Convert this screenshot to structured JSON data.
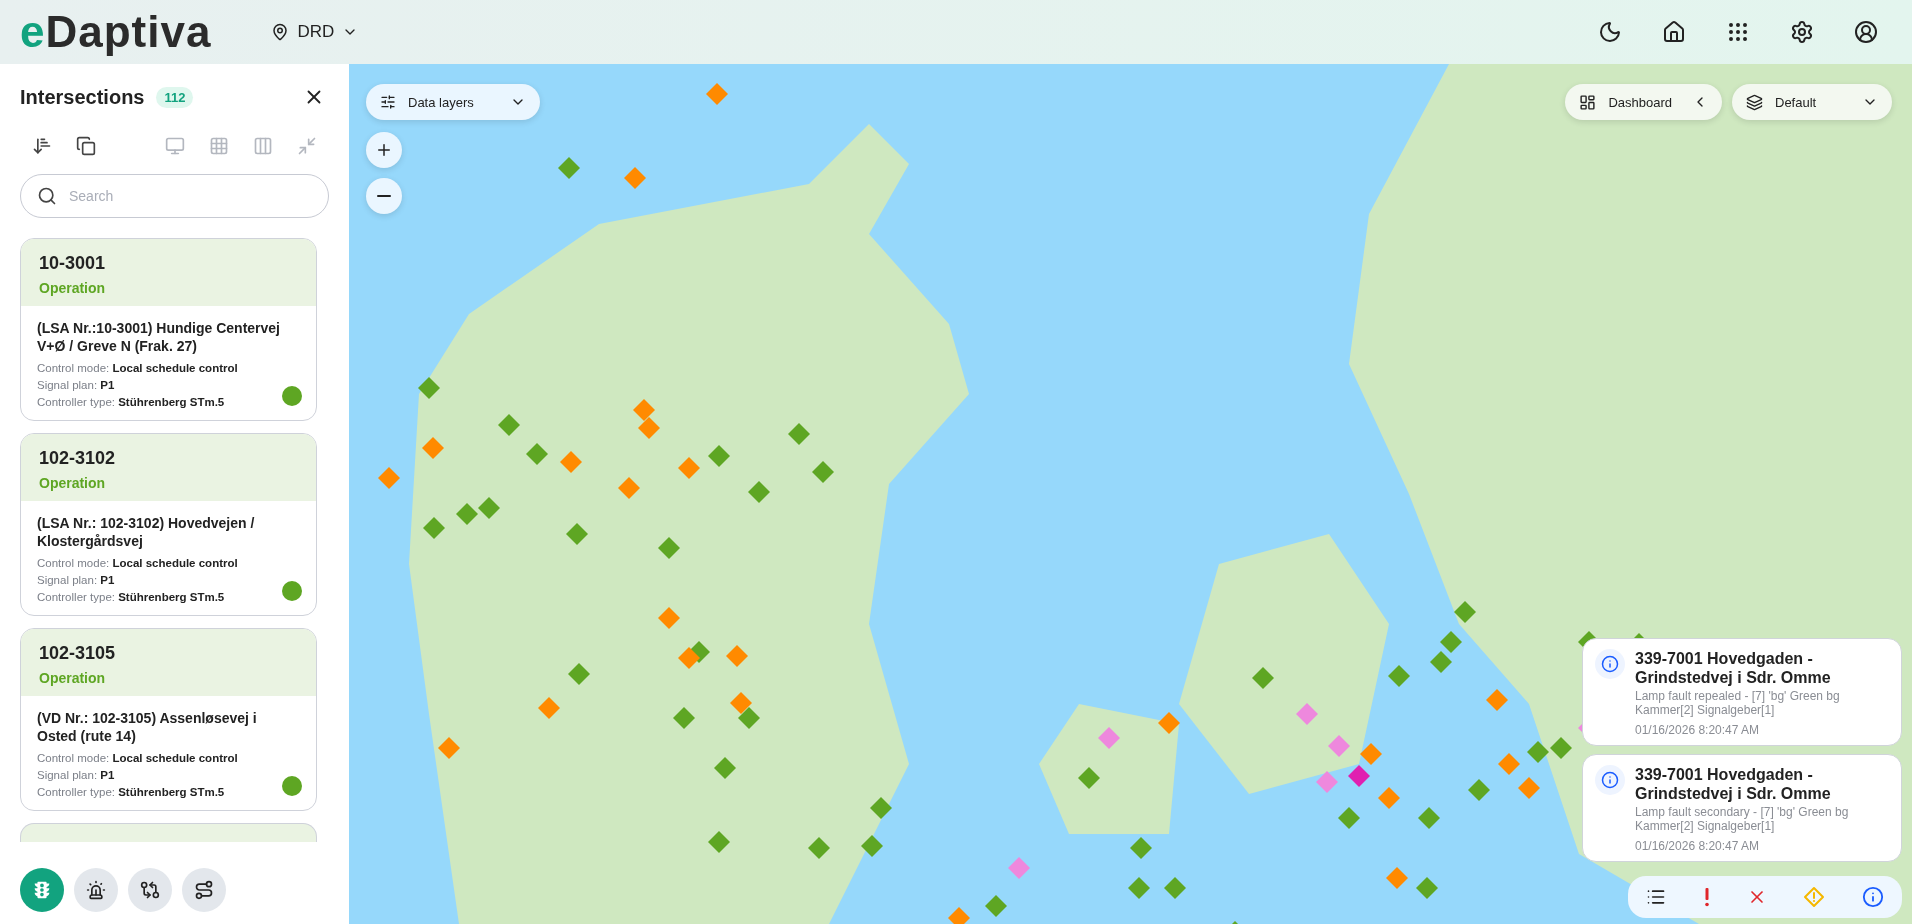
{
  "header": {
    "logo": {
      "accent": "e",
      "rest": "Daptiva"
    },
    "location": "DRD"
  },
  "sidebar": {
    "title": "Intersections",
    "count": "112",
    "search": {
      "placeholder": "Search"
    },
    "cards": [
      {
        "id": "10-3001",
        "status": "Operation",
        "title": "(LSA Nr.:10-3001) Hundige Centervej V+Ø / Greve N (Frak. 27)",
        "fields": [
          {
            "label": "Control mode:",
            "value": "Local schedule control"
          },
          {
            "label": "Signal plan:",
            "value": "P1"
          },
          {
            "label": "Controller type:",
            "value": "Stührenberg STm.5"
          }
        ],
        "color": "#5ea623"
      },
      {
        "id": "102-3102",
        "status": "Operation",
        "title": "(LSA Nr.: 102-3102) Hovedvejen / Klostergårdsvej",
        "fields": [
          {
            "label": "Control mode:",
            "value": "Local schedule control"
          },
          {
            "label": "Signal plan:",
            "value": "P1"
          },
          {
            "label": "Controller type:",
            "value": "Stührenberg STm.5"
          }
        ],
        "color": "#5ea623"
      },
      {
        "id": "102-3105",
        "status": "Operation",
        "title": "(VD Nr.: 102-3105) Assenløsevej i Osted (rute 14)",
        "fields": [
          {
            "label": "Control mode:",
            "value": "Local schedule control"
          },
          {
            "label": "Signal plan:",
            "value": "P1"
          },
          {
            "label": "Controller type:",
            "value": "Stührenberg STm.5"
          }
        ],
        "color": "#5ea623"
      }
    ],
    "bottom_tabs": [
      {
        "kind": "traffic",
        "selected": true
      },
      {
        "kind": "alarm",
        "selected": false
      },
      {
        "kind": "compare",
        "selected": false
      },
      {
        "kind": "route",
        "selected": false
      }
    ]
  },
  "map": {
    "data_layers": "Data layers",
    "dashboard": "Dashboard",
    "layer_select": "Default"
  },
  "notifications": [
    {
      "kind": "info",
      "title": "339-7001 Hovedgaden - Grindstedvej i Sdr. Omme",
      "message": "Lamp fault repealed - [7] 'bg' Green bg Kammer[2] Signalgeber[1]",
      "time": "01/16/2026 8:20:47 AM"
    },
    {
      "kind": "info",
      "title": "339-7001 Hovedgaden - Grindstedvej i Sdr. Omme",
      "message": "Lamp fault secondary - [7] 'bg' Green bg Kammer[2] Signalgeber[1]",
      "time": "01/16/2026 8:20:47 AM"
    }
  ],
  "filters": [
    {
      "kind": "all"
    },
    {
      "kind": "error"
    },
    {
      "kind": "fault"
    },
    {
      "kind": "warning"
    },
    {
      "kind": "info"
    }
  ]
}
